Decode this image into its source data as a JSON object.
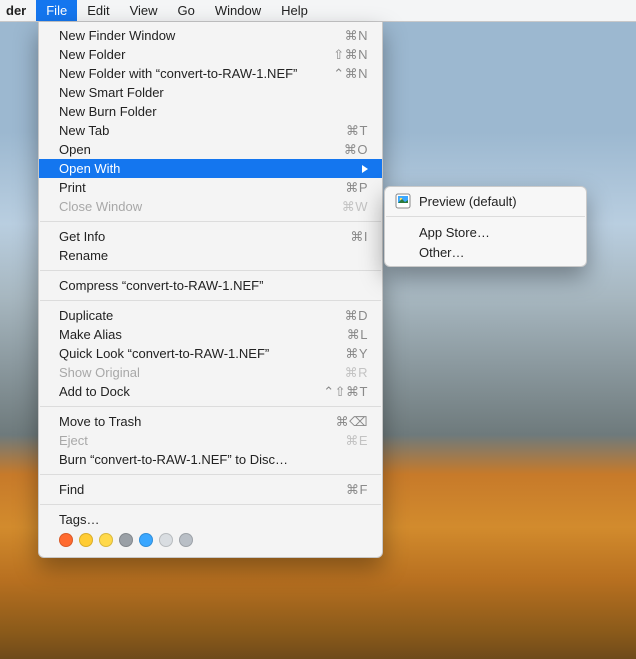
{
  "menubar": {
    "app_name": "der",
    "items": [
      "File",
      "Edit",
      "View",
      "Go",
      "Window",
      "Help"
    ],
    "active_index": 0
  },
  "file_menu": {
    "groups": [
      [
        {
          "label": "New Finder Window",
          "shortcut": "⌘N"
        },
        {
          "label": "New Folder",
          "shortcut": "⇧⌘N"
        },
        {
          "label": "New Folder with “convert-to-RAW-1.NEF”",
          "shortcut": "⌃⌘N"
        },
        {
          "label": "New Smart Folder",
          "shortcut": ""
        },
        {
          "label": "New Burn Folder",
          "shortcut": ""
        },
        {
          "label": "New Tab",
          "shortcut": "⌘T"
        },
        {
          "label": "Open",
          "shortcut": "⌘O"
        },
        {
          "label": "Open With",
          "shortcut": "",
          "submenu": true,
          "highlight": true
        },
        {
          "label": "Print",
          "shortcut": "⌘P"
        },
        {
          "label": "Close Window",
          "shortcut": "⌘W",
          "disabled": true
        }
      ],
      [
        {
          "label": "Get Info",
          "shortcut": "⌘I"
        },
        {
          "label": "Rename",
          "shortcut": ""
        }
      ],
      [
        {
          "label": "Compress “convert-to-RAW-1.NEF”",
          "shortcut": ""
        }
      ],
      [
        {
          "label": "Duplicate",
          "shortcut": "⌘D"
        },
        {
          "label": "Make Alias",
          "shortcut": "⌘L"
        },
        {
          "label": "Quick Look “convert-to-RAW-1.NEF”",
          "shortcut": "⌘Y"
        },
        {
          "label": "Show Original",
          "shortcut": "⌘R",
          "disabled": true
        },
        {
          "label": "Add to Dock",
          "shortcut": "⌃⇧⌘T"
        }
      ],
      [
        {
          "label": "Move to Trash",
          "shortcut": "⌘⌫"
        },
        {
          "label": "Eject",
          "shortcut": "⌘E",
          "disabled": true
        },
        {
          "label": "Burn “convert-to-RAW-1.NEF” to Disc…",
          "shortcut": ""
        }
      ],
      [
        {
          "label": "Find",
          "shortcut": "⌘F"
        }
      ],
      [
        {
          "label": "Tags…",
          "shortcut": ""
        }
      ]
    ],
    "tags": [
      "#ff6a2f",
      "#ffcc33",
      "#ffd94a",
      "#9aa0a6",
      "#3aa7ff",
      "#d9dde1",
      "#b9bfc6"
    ]
  },
  "open_with_submenu": {
    "default_item": {
      "label": "Preview (default)"
    },
    "items": [
      {
        "label": "App Store…"
      },
      {
        "label": "Other…"
      }
    ]
  }
}
